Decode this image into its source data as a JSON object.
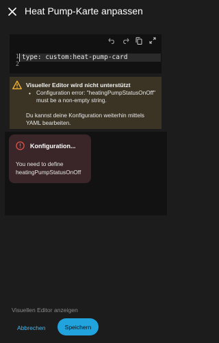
{
  "dialog": {
    "title": "Heat Pump-Karte anpassen",
    "close_icon": "close-icon"
  },
  "editor": {
    "toolbar_icons": [
      "undo-icon",
      "redo-icon",
      "copy-icon",
      "fullscreen-icon"
    ],
    "line_numbers": [
      "1",
      "2"
    ],
    "code_lines": [
      "type: custom:heat-pump-card",
      ""
    ]
  },
  "warning": {
    "icon": "alert-triangle-icon",
    "color": "#f3b431",
    "title": "Visueller Editor wird nicht unterstützt",
    "bullet": "•",
    "bullet_text": "Configuration error: \"heatingPumpStatusOnOff\" must be a non-empty string.",
    "footer": "Du kannst deine Konfiguration weiterhin mittels YAML bearbeiten."
  },
  "preview_error": {
    "icon": "alert-circle-icon",
    "color": "#e0544c",
    "title": "Konfiguration...",
    "message": "You need to define heatingPumpStatusOnOff"
  },
  "footer": {
    "toggle_visual_label": "Visuellen Editor anzeigen",
    "cancel_label": "Abbrechen",
    "save_label": "Speichern",
    "accent_color": "#21a3de"
  }
}
